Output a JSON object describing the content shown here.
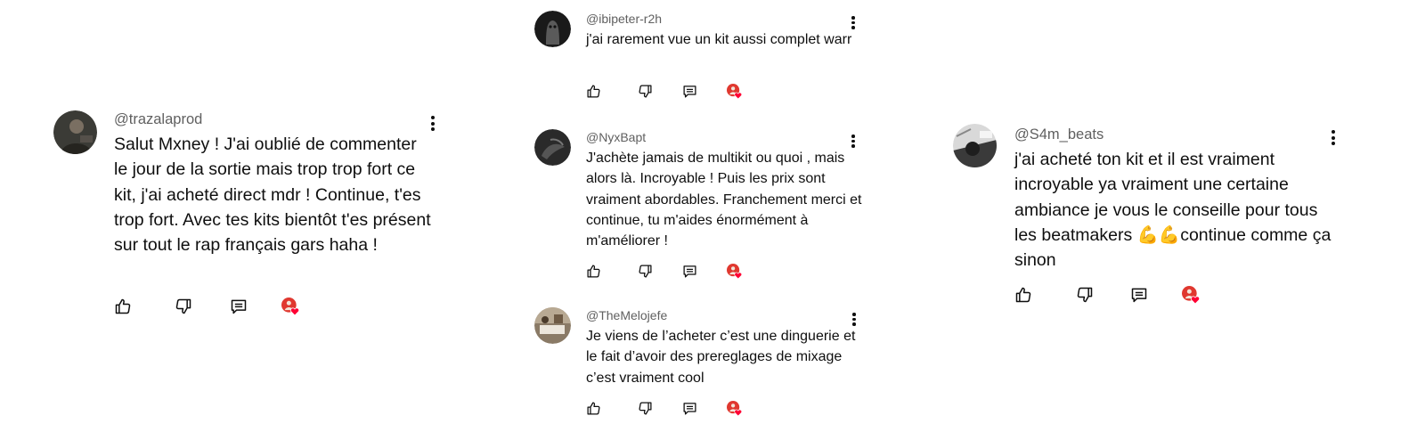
{
  "comments": [
    {
      "handle": "@trazalaprod",
      "text": "Salut Mxney ! J'ai oublié de commenter le jour de la sortie mais trop trop fort ce kit, j'ai acheté direct mdr ! Continue, t'es trop fort. Avec tes kits bientôt t'es présent sur tout le rap français gars haha !"
    },
    {
      "handle": "@ibipeter-r2h",
      "text": "j'ai rarement vue un kit aussi complet warr"
    },
    {
      "handle": "@NyxBapt",
      "text": "J'achète jamais de multikit ou quoi , mais alors là. Incroyable ! Puis les prix sont vraiment abordables. Franchement merci et continue, tu m'aides énormément à m'améliorer !"
    },
    {
      "handle": "@TheMelojefe",
      "text": "Je viens de l’acheter c’est une dinguerie et le fait d’avoir des prereglages de mixage c’est vraiment cool"
    },
    {
      "handle": "@S4m_beats",
      "text": "j'ai acheté ton kit et il est vraiment incroyable ya vraiment une certaine ambiance je vous le conseille pour tous les beatmakers 💪💪continue comme ça sinon"
    }
  ],
  "icons": {
    "like": "thumbs-up-icon",
    "dislike": "thumbs-down-icon",
    "reply": "reply-comment-icon",
    "creator_heart": "creator-heart-badge",
    "more": "more-vertical-icon"
  },
  "colors": {
    "text": "#0f0f0f",
    "handle": "#606060",
    "heart": "#ff0033"
  }
}
